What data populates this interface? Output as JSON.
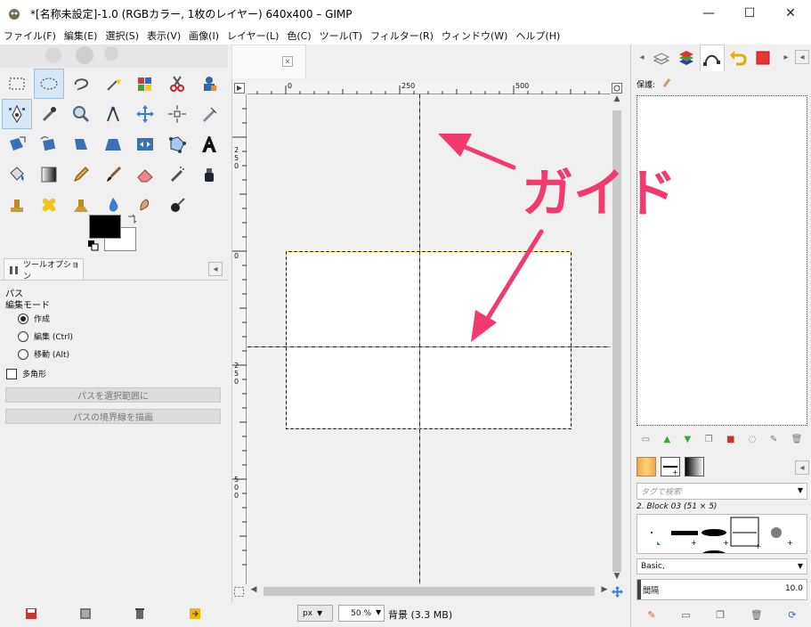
{
  "window": {
    "title": "*[名称未設定]-1.0 (RGBカラー, 1枚のレイヤー) 640x400 – GIMP",
    "minimize": "—",
    "maximize": "☐",
    "close": "✕"
  },
  "menu": [
    "ファイル(F)",
    "編集(E)",
    "選択(S)",
    "表示(V)",
    "画像(I)",
    "レイヤー(L)",
    "色(C)",
    "ツール(T)",
    "フィルター(R)",
    "ウィンドウ(W)",
    "ヘルプ(H)"
  ],
  "tool_options": {
    "tab_label": "ツールオプション",
    "tool_name": "パス",
    "mode_label": "編集モード",
    "modes": [
      "作成",
      "編集 (Ctrl)",
      "移動 (Alt)"
    ],
    "selected_mode": 0,
    "polygon_label": "多角形",
    "btn_selection": "パスを選択範囲に",
    "btn_stroke": "パスの境界線を描画"
  },
  "ruler": {
    "top_ticks": [
      "0",
      "250",
      "500"
    ],
    "left_ticks": [
      "2 5 0",
      "0",
      "2 5 0",
      "5 0 0"
    ]
  },
  "status": {
    "unit": "px",
    "zoom": "50 %",
    "info": "背景 (3.3 MB)"
  },
  "right": {
    "mode_label": "保護:",
    "tag_placeholder": "タグで検索",
    "brush_name": "2. Block 03 (51 × 5)",
    "preset": "Basic,",
    "spacing_label": "間隔",
    "spacing_value": "10.0"
  },
  "annotation": {
    "text": "ガイド",
    "color": "#f23a6e"
  }
}
